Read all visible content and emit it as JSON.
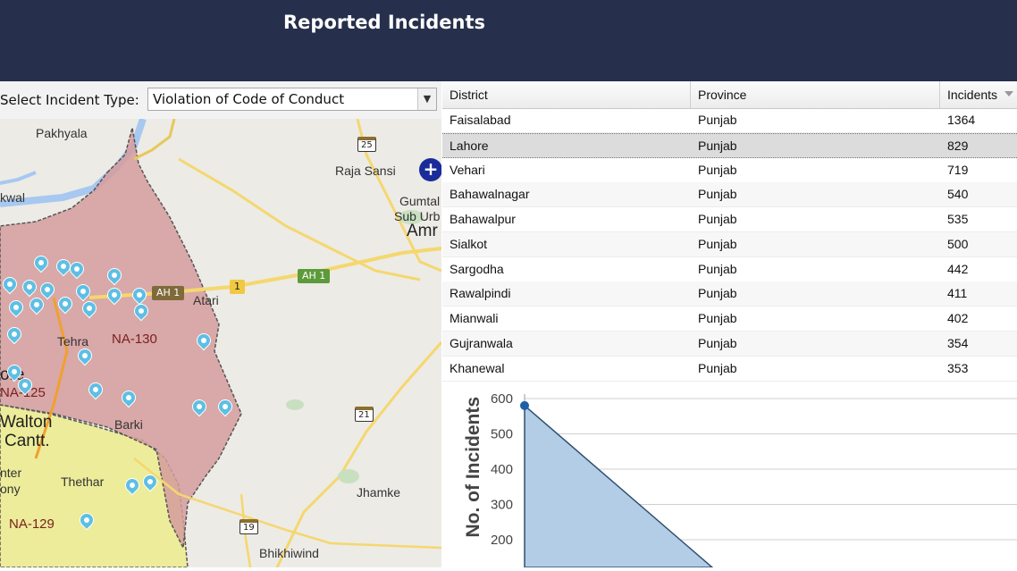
{
  "header": {
    "title": "Reported Incidents"
  },
  "filter": {
    "label": "Select Incident Type:",
    "value": "Violation of Code of Conduct"
  },
  "map": {
    "place_labels": [
      "Pakhyala",
      "Raja Sansi",
      "Gumtal",
      "Sub Urb",
      "Amr",
      "kwal",
      "Atari",
      "Tehra",
      "ore",
      "Walton",
      "Cantt.",
      "nter",
      "ony",
      "Thethar",
      "Barki",
      "Jhamke",
      "Bhikhiwind"
    ],
    "constituencies": [
      "NA-130",
      "NA-125",
      "NA-129"
    ],
    "road_labels": [
      "25",
      "AH 1",
      "AH 1",
      "1",
      "21",
      "19"
    ],
    "zoom_control_label": "+"
  },
  "table": {
    "columns": [
      "District",
      "Province",
      "Incidents"
    ],
    "rows": [
      {
        "district": "Faisalabad",
        "province": "Punjab",
        "incidents": "1364"
      },
      {
        "district": "Lahore",
        "province": "Punjab",
        "incidents": "829"
      },
      {
        "district": "Vehari",
        "province": "Punjab",
        "incidents": "719"
      },
      {
        "district": "Bahawalnagar",
        "province": "Punjab",
        "incidents": "540"
      },
      {
        "district": "Bahawalpur",
        "province": "Punjab",
        "incidents": "535"
      },
      {
        "district": "Sialkot",
        "province": "Punjab",
        "incidents": "500"
      },
      {
        "district": "Sargodha",
        "province": "Punjab",
        "incidents": "442"
      },
      {
        "district": "Rawalpindi",
        "province": "Punjab",
        "incidents": "411"
      },
      {
        "district": "Mianwali",
        "province": "Punjab",
        "incidents": "402"
      },
      {
        "district": "Gujranwala",
        "province": "Punjab",
        "incidents": "354"
      },
      {
        "district": "Khanewal",
        "province": "Punjab",
        "incidents": "353"
      }
    ],
    "selected_row": 1
  },
  "chart_data": {
    "type": "area",
    "ylabel": "No. of Incidents",
    "yticks": [
      "600",
      "500",
      "400",
      "300",
      "200"
    ],
    "ylim": [
      100,
      620
    ],
    "series": [
      {
        "values": [
          580,
          100
        ]
      }
    ],
    "color": "#b3cde6"
  }
}
